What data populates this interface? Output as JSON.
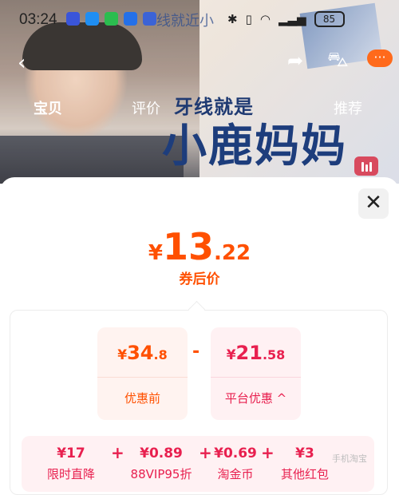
{
  "status_bar": {
    "time": "03:24",
    "ticker": "线就近小",
    "battery": "85"
  },
  "background": {
    "tabs": [
      "宝贝",
      "评价",
      "推荐"
    ],
    "promo_small": "牙线就是",
    "promo_big": "小鹿妈妈"
  },
  "sheet": {
    "close_symbol": "✕",
    "final_price": {
      "currency": "¥",
      "integer": "13",
      "decimal": ".22"
    },
    "final_label": "券后价",
    "original": {
      "currency": "¥",
      "integer": "34",
      "decimal": ".8",
      "label": "优惠前"
    },
    "minus": "-",
    "platform": {
      "currency": "¥",
      "integer": "21",
      "decimal": ".58",
      "label": "平台优惠",
      "chevron": "^"
    },
    "breakdown": [
      {
        "amount": "¥17",
        "name": "限时直降"
      },
      {
        "amount": "¥0.89",
        "name": "88VIP95折"
      },
      {
        "amount": "¥0.69",
        "name": "淘金币"
      },
      {
        "amount": "¥3",
        "name": "其他红包"
      }
    ],
    "plus": "+"
  },
  "watermark": "手机淘宝",
  "colors": {
    "accent_orange": "#ff5000",
    "accent_red": "#e8204f"
  }
}
